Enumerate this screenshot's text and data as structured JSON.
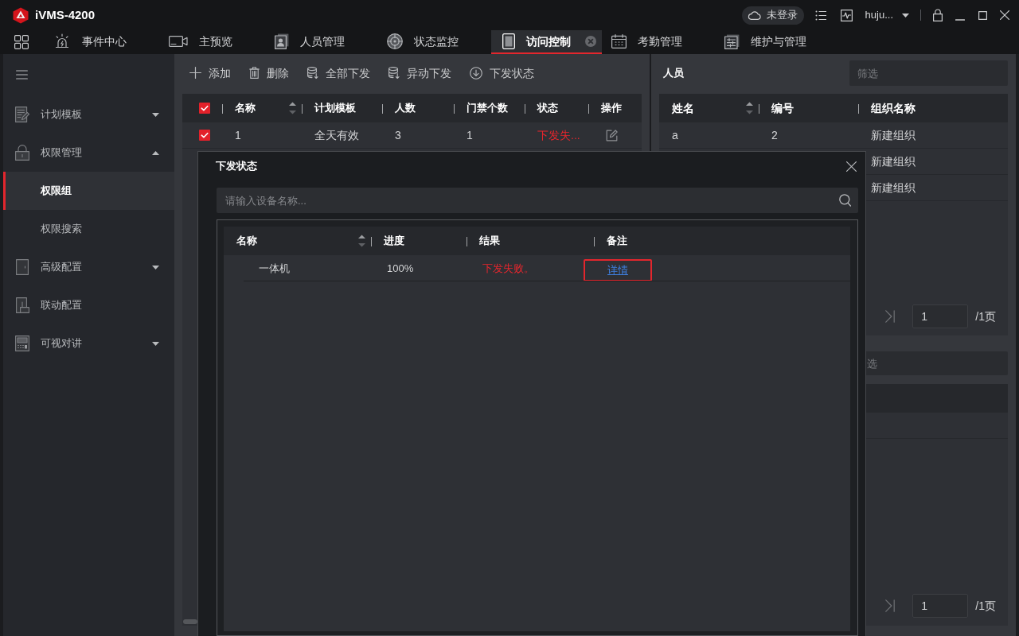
{
  "window": {
    "title": "iVMS-4200"
  },
  "title_bar": {
    "cloud_status": "未登录",
    "user": "huju..."
  },
  "nav_tabs": [
    {
      "label": "事件中心",
      "selected": false
    },
    {
      "label": "主预览",
      "selected": false
    },
    {
      "label": "人员管理",
      "selected": false
    },
    {
      "label": "状态监控",
      "selected": false
    },
    {
      "label": "访问控制",
      "selected": true
    },
    {
      "label": "考勤管理",
      "selected": false
    },
    {
      "label": "维护与管理",
      "selected": false
    }
  ],
  "sidebar": {
    "items": [
      {
        "label": "计划模板",
        "kind": "group",
        "expanded": false
      },
      {
        "label": "权限管理",
        "kind": "group",
        "expanded": true,
        "children": [
          {
            "label": "权限组",
            "selected": true
          },
          {
            "label": "权限搜索",
            "selected": false
          }
        ]
      },
      {
        "label": "高级配置",
        "kind": "group",
        "expanded": false
      },
      {
        "label": "联动配置",
        "kind": "link"
      },
      {
        "label": "可视对讲",
        "kind": "group",
        "expanded": false
      }
    ]
  },
  "toolbar": [
    "添加",
    "删除",
    "全部下发",
    "异动下发",
    "下发状态"
  ],
  "access_groups": {
    "select_all": true,
    "columns": [
      {
        "label": "名称",
        "sortable": true
      },
      {
        "label": "计划模板",
        "sortable": false
      },
      {
        "label": "人数",
        "sortable": false
      },
      {
        "label": "门禁个数",
        "sortable": false
      },
      {
        "label": "状态",
        "sortable": false
      },
      {
        "label": "操作",
        "sortable": false
      }
    ],
    "rows": [
      {
        "checked": true,
        "cells": [
          "1",
          "全天有效",
          "3",
          "1"
        ],
        "status": {
          "text": "下发失...",
          "kind": "error"
        }
      }
    ]
  },
  "persons_panel": {
    "title": "人员",
    "filter": {
      "placeholder": "筛选"
    },
    "columns": [
      {
        "label": "姓名",
        "sortable": true
      },
      {
        "label": "编号",
        "sortable": false
      },
      {
        "label": "组织名称",
        "sortable": false
      }
    ],
    "rows": [
      {
        "name": "a",
        "number": "2",
        "organization": "新建组织"
      },
      {
        "organization": "新建组织"
      },
      {
        "organization": "新建组织"
      }
    ],
    "pagination": {
      "page": "1",
      "total": "/1页"
    }
  },
  "lower_panel": {
    "filter": {
      "placeholder": "选"
    },
    "pagination": {
      "page": "1",
      "total": "/1页"
    }
  },
  "dialog": {
    "title": "下发状态",
    "search": {
      "placeholder": "请输入设备名称..."
    },
    "columns": [
      {
        "label": "名称",
        "sortable": true
      },
      {
        "label": "进度",
        "sortable": false
      },
      {
        "label": "结果",
        "sortable": false
      },
      {
        "label": "备注",
        "sortable": false
      }
    ],
    "rows": [
      {
        "name": "一体机",
        "progress": "100%",
        "result": {
          "text": "下发失败。",
          "kind": "error"
        },
        "remark": {
          "text": "详情",
          "highlighted": true
        }
      }
    ]
  }
}
